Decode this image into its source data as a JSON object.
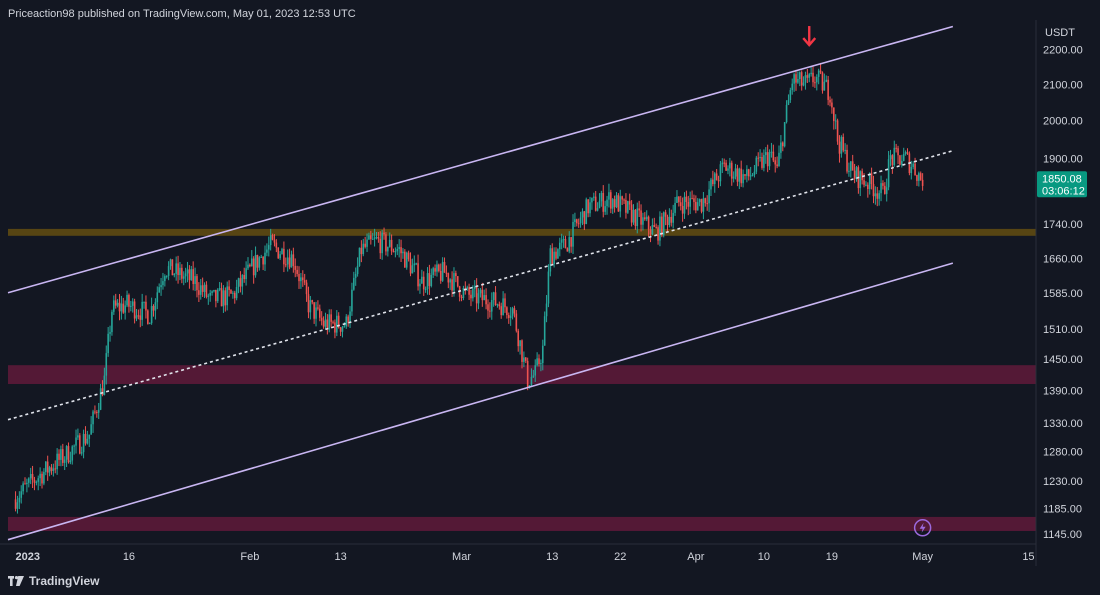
{
  "header": {
    "published_text": "Priceaction98 published on TradingView.com, May 01, 2023 12:53 UTC"
  },
  "footer": {
    "brand": "TradingView",
    "logo_icon": "tradingview-logo-icon"
  },
  "colors": {
    "background": "#131722",
    "up_candle": "#26a69a",
    "down_candle": "#ef5350",
    "channel_line": "#c9b6f2",
    "midline": "#e0e3eb",
    "support_yellow": "#5f4a12",
    "support_magenta": "#5c1a38",
    "price_tag": "#089981",
    "arrow": "#f23645"
  },
  "chart_data": {
    "type": "candlestick",
    "symbol_quote": "USDT",
    "y_axis": {
      "unit": "USDT",
      "scale": "log",
      "ticks": [
        2200,
        2100,
        2000,
        1900,
        1740,
        1660,
        1585,
        1510,
        1450,
        1390,
        1330,
        1280,
        1230,
        1185,
        1145
      ],
      "range": [
        1130,
        2290
      ]
    },
    "x_axis": {
      "start": "2022-12-31",
      "end": "2023-05-16",
      "tick_labels": [
        {
          "date": "2023-01-01",
          "label": "2023",
          "bold": true
        },
        {
          "date": "2023-01-16",
          "label": "16"
        },
        {
          "date": "2023-02-01",
          "label": "Feb"
        },
        {
          "date": "2023-02-13",
          "label": "13"
        },
        {
          "date": "2023-03-01",
          "label": "Mar"
        },
        {
          "date": "2023-03-13",
          "label": "13"
        },
        {
          "date": "2023-03-22",
          "label": "22"
        },
        {
          "date": "2023-04-01",
          "label": "Apr"
        },
        {
          "date": "2023-04-10",
          "label": "10"
        },
        {
          "date": "2023-04-19",
          "label": "19"
        },
        {
          "date": "2023-05-01",
          "label": "May"
        },
        {
          "date": "2023-05-15",
          "label": "15"
        }
      ]
    },
    "price_path": [
      [
        "2023-01-01",
        1200
      ],
      [
        "2023-01-04",
        1235
      ],
      [
        "2023-01-08",
        1275
      ],
      [
        "2023-01-11",
        1310
      ],
      [
        "2023-01-13",
        1410
      ],
      [
        "2023-01-14",
        1550
      ],
      [
        "2023-01-16",
        1560
      ],
      [
        "2023-01-19",
        1540
      ],
      [
        "2023-01-21",
        1640
      ],
      [
        "2023-01-25",
        1610
      ],
      [
        "2023-01-27",
        1570
      ],
      [
        "2023-01-30",
        1580
      ],
      [
        "2023-02-02",
        1650
      ],
      [
        "2023-02-04",
        1690
      ],
      [
        "2023-02-07",
        1660
      ],
      [
        "2023-02-09",
        1560
      ],
      [
        "2023-02-11",
        1520
      ],
      [
        "2023-02-14",
        1520
      ],
      [
        "2023-02-16",
        1680
      ],
      [
        "2023-02-18",
        1700
      ],
      [
        "2023-02-21",
        1680
      ],
      [
        "2023-02-24",
        1610
      ],
      [
        "2023-02-27",
        1630
      ],
      [
        "2023-03-02",
        1580
      ],
      [
        "2023-03-06",
        1565
      ],
      [
        "2023-03-08",
        1550
      ],
      [
        "2023-03-10",
        1410
      ],
      [
        "2023-03-11",
        1420
      ],
      [
        "2023-03-12",
        1470
      ],
      [
        "2023-03-13",
        1670
      ],
      [
        "2023-03-15",
        1690
      ],
      [
        "2023-03-18",
        1780
      ],
      [
        "2023-03-21",
        1800
      ],
      [
        "2023-03-24",
        1760
      ],
      [
        "2023-03-27",
        1720
      ],
      [
        "2023-03-30",
        1790
      ],
      [
        "2023-04-02",
        1790
      ],
      [
        "2023-04-05",
        1880
      ],
      [
        "2023-04-08",
        1850
      ],
      [
        "2023-04-11",
        1910
      ],
      [
        "2023-04-12",
        1870
      ],
      [
        "2023-04-14",
        2110
      ],
      [
        "2023-04-16",
        2100
      ],
      [
        "2023-04-17",
        2120
      ],
      [
        "2023-04-19",
        2080
      ],
      [
        "2023-04-20",
        1950
      ],
      [
        "2023-04-22",
        1860
      ],
      [
        "2023-04-24",
        1840
      ],
      [
        "2023-04-26",
        1810
      ],
      [
        "2023-04-27",
        1900
      ],
      [
        "2023-04-29",
        1900
      ],
      [
        "2023-04-30",
        1880
      ],
      [
        "2023-05-01",
        1850
      ]
    ],
    "channel": {
      "upper": [
        [
          "2023-01-01",
          1590
        ],
        [
          "2023-05-05",
          2270
        ]
      ],
      "middle_dotted": [
        [
          "2023-01-01",
          1340
        ],
        [
          "2023-05-05",
          1920
        ]
      ],
      "lower": [
        [
          "2023-01-01",
          1140
        ],
        [
          "2023-05-05",
          1650
        ]
      ],
      "extends_to": "2023-05-05"
    },
    "zones": [
      {
        "name": "yellow support",
        "from": 1712,
        "to": 1728,
        "color": "#5f4a12"
      },
      {
        "name": "magenta support",
        "from": 1402,
        "to": 1438,
        "color": "#5c1a38"
      },
      {
        "name": "magenta support low",
        "from": 1150,
        "to": 1172,
        "color": "#5c1a38"
      }
    ],
    "annotations": [
      {
        "type": "arrow-down",
        "date": "2023-04-16",
        "price": 2235,
        "color": "#f23645"
      },
      {
        "type": "lightning-icon",
        "date": "2023-05-01",
        "price": 1155,
        "color": "#9c6ade"
      }
    ],
    "last_price": {
      "value": "1850.08",
      "countdown": "03:06:12",
      "price": 1850.08
    }
  }
}
